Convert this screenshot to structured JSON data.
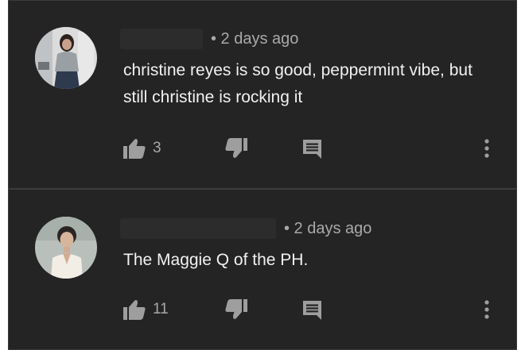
{
  "comments": [
    {
      "author": "",
      "timestamp": "• 2 days ago",
      "text": "christine reyes is so good, peppermint vibe, but still christine is rocking it",
      "likes": "3",
      "avatar_icon": "profile-photo"
    },
    {
      "author": "",
      "timestamp": "• 2 days ago",
      "text": "The Maggie Q of the PH.",
      "likes": "11",
      "avatar_icon": "profile-photo"
    }
  ],
  "icons": {
    "like": "thumb-up-icon",
    "dislike": "thumb-down-icon",
    "reply": "reply-icon",
    "more": "more-vert-icon"
  },
  "colors": {
    "background": "#242424",
    "text": "#f1f1f1",
    "secondary_text": "#a9a9a9",
    "icon": "#9e9e9e"
  }
}
